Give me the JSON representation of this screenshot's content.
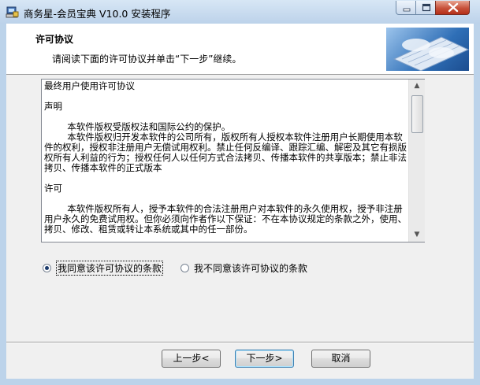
{
  "window": {
    "title": "商务星-会员宝典 V10.0 安装程序"
  },
  "header": {
    "title": "许可协议",
    "subtitle": "请阅读下面的许可协议并单击“下一步”继续。"
  },
  "license": {
    "text": "最终用户使用许可协议\n\n声明\n\n        本软件版权受版权法和国际公约的保护。\n        本软件版权归开发本软件的公司所有，版权所有人授权本软件注册用户长期使用本软件的权利，授权非注册用户无偿试用权利。禁止任何反编译、跟踪汇编、解密及其它有损版权所有人利益的行为；授权任何人以任何方式合法拷贝、传播本软件的共享版本；禁止非法拷贝、传播本软件的正式版本\n\n许可\n\n        本软件版权所有人，授予本软件的合法注册用户对本软件的永久使用权，授予非注册用户永久的免费试用权。但你必须向作者作以下保证：不在本协议规定的条款之外，使用、拷贝、修改、租赁或转让本系统或其中的任一部份。"
  },
  "options": {
    "agree": "我同意该许可协议的条款",
    "disagree": "我不同意该许可协议的条款",
    "selected": "agree"
  },
  "buttons": {
    "back": "上一步<",
    "next": "下一步>",
    "cancel": "取消"
  },
  "icons": {
    "app": "installer-computer-icon",
    "header_image": "keyboard-hands-image",
    "scroll_up": "▲",
    "scroll_down": "▼"
  }
}
